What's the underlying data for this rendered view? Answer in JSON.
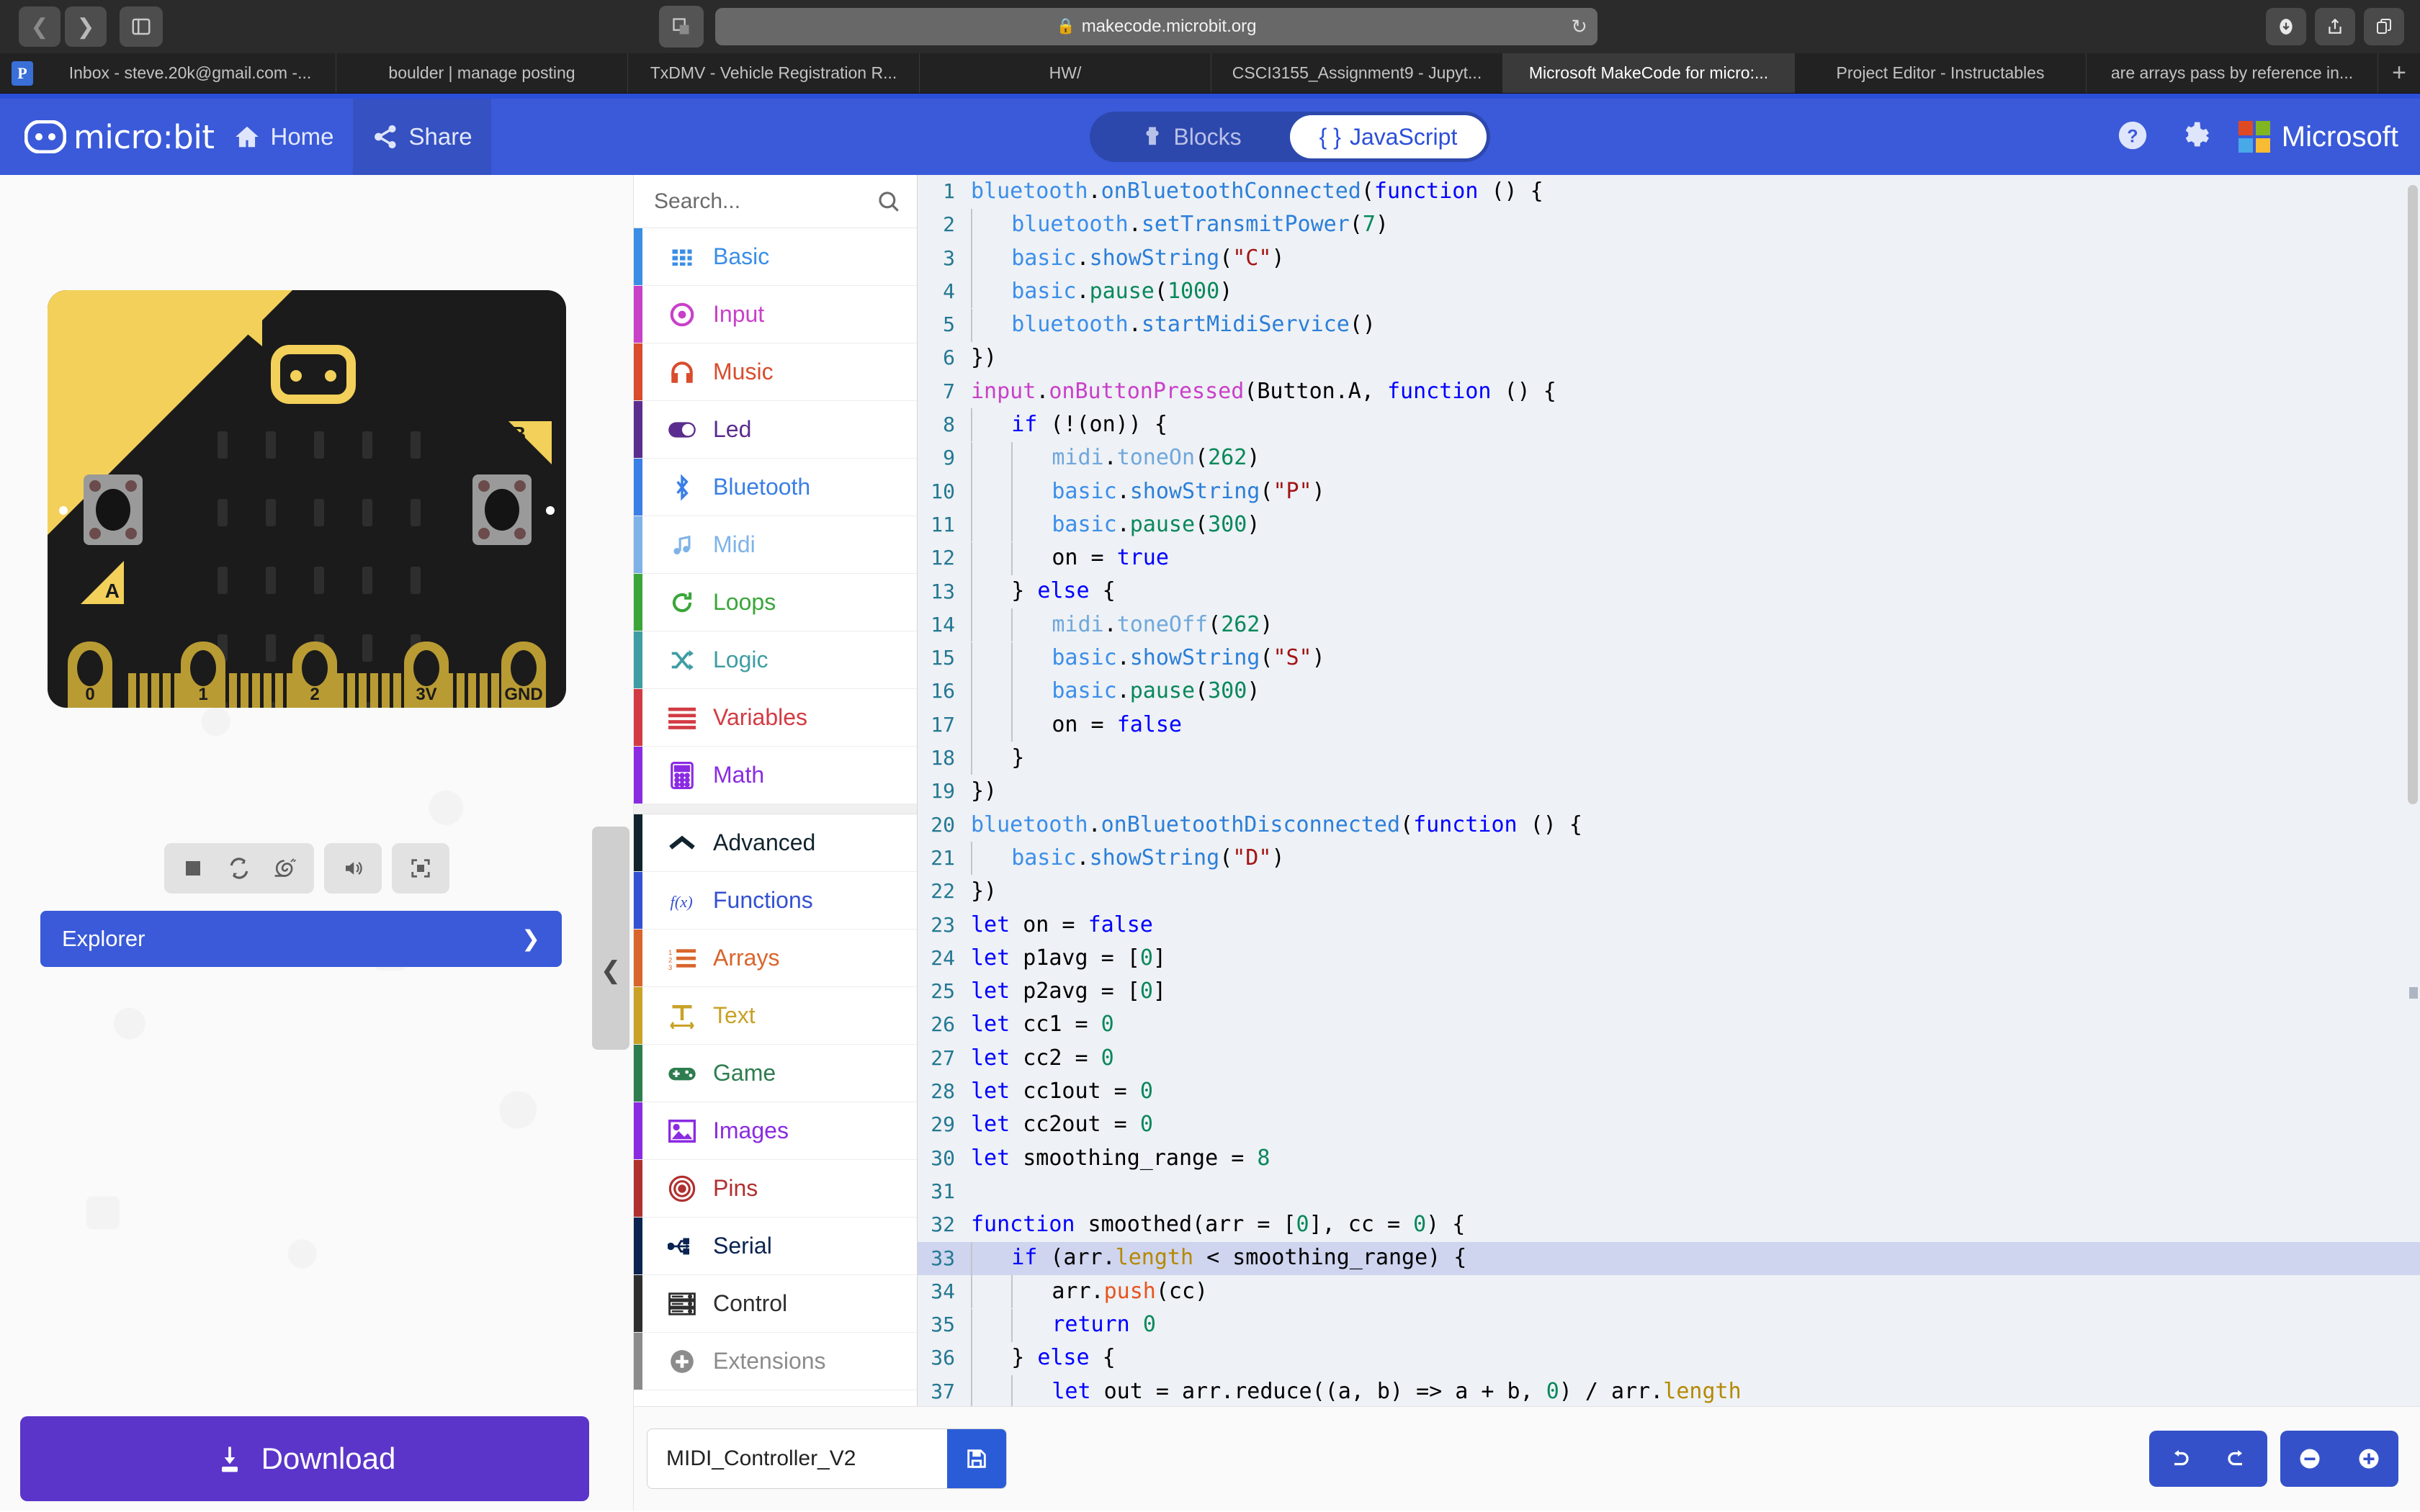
{
  "browser": {
    "url": "makecode.microbit.org",
    "lock_icon": "lock-icon",
    "back_icon": "back-arrow-icon",
    "forward_icon": "forward-arrow-icon",
    "sidebar_icon": "sidebar-toggle-icon",
    "tabgrid_icon": "tab-overview-icon",
    "reload_icon": "reload-icon",
    "download_icon": "downloads-icon",
    "share_icon": "share-icon",
    "tabs_icon": "tabs-icon",
    "favorite_letter": "P",
    "new_tab_label": "+",
    "tabs": [
      {
        "title": "Inbox - steve.20k@gmail.com -...",
        "active": false
      },
      {
        "title": "boulder | manage posting",
        "active": false
      },
      {
        "title": "TxDMV - Vehicle Registration R...",
        "active": false
      },
      {
        "title": "HW/",
        "active": false
      },
      {
        "title": "CSCI3155_Assignment9 - Jupyt...",
        "active": false
      },
      {
        "title": "Microsoft MakeCode for micro:...",
        "active": true
      },
      {
        "title": "Project Editor - Instructables",
        "active": false
      },
      {
        "title": "are arrays pass by reference in...",
        "active": false
      }
    ]
  },
  "header": {
    "brand": "micro:bit",
    "home_label": "Home",
    "share_label": "Share",
    "blocks_label": "Blocks",
    "javascript_label": "JavaScript",
    "javascript_braces": "{ }",
    "help_icon": "help-circle-icon",
    "settings_icon": "gear-icon",
    "microsoft_label": "Microsoft",
    "brand_color": "#3a5ad9"
  },
  "simulator": {
    "board_pins": [
      "0",
      "1",
      "2",
      "3V",
      "GND"
    ],
    "button_a_label": "A",
    "button_b_label": "B",
    "controls": [
      {
        "name": "stop-button",
        "icon": "stop-icon"
      },
      {
        "name": "restart-button",
        "icon": "restart-icon"
      },
      {
        "name": "slow-motion-button",
        "icon": "snail-icon"
      },
      {
        "name": "mute-button",
        "icon": "speaker-icon"
      },
      {
        "name": "fullscreen-button",
        "icon": "fullscreen-icon"
      }
    ],
    "explorer_label": "Explorer",
    "explorer_chevron": "❯",
    "download_label": "Download",
    "download_icon": "download-icon",
    "download_color": "#5b35c9"
  },
  "toolbox": {
    "search_placeholder": "Search...",
    "search_icon": "search-icon",
    "categories": [
      {
        "label": "Basic",
        "color": "#3a8ee6",
        "icon": "grid-icon",
        "group": "core"
      },
      {
        "label": "Input",
        "color": "#c940c9",
        "icon": "target-dot-icon",
        "group": "core"
      },
      {
        "label": "Music",
        "color": "#d94c2c",
        "icon": "headphones-icon",
        "group": "core"
      },
      {
        "label": "Led",
        "color": "#5b2d8e",
        "icon": "toggle-icon",
        "group": "core"
      },
      {
        "label": "Bluetooth",
        "color": "#3a7fe6",
        "icon": "bluetooth-icon",
        "group": "core"
      },
      {
        "label": "Midi",
        "color": "#7fb3e8",
        "icon": "music-note-icon",
        "group": "core"
      },
      {
        "label": "Loops",
        "color": "#3aa63a",
        "icon": "loop-arrow-icon",
        "group": "core"
      },
      {
        "label": "Logic",
        "color": "#3f9da3",
        "icon": "shuffle-icon",
        "group": "core"
      },
      {
        "label": "Variables",
        "color": "#d23b43",
        "icon": "lines-icon",
        "group": "core"
      },
      {
        "label": "Math",
        "color": "#8a2be2",
        "icon": "calculator-icon",
        "group": "core"
      },
      {
        "label": "Advanced",
        "color": "#11242e",
        "icon": "chevron-up-icon",
        "group": "advanced-toggle"
      },
      {
        "label": "Functions",
        "color": "#3451d1",
        "icon": "fx-icon",
        "group": "advanced"
      },
      {
        "label": "Arrays",
        "color": "#d9652c",
        "icon": "numbered-list-icon",
        "group": "advanced"
      },
      {
        "label": "Text",
        "color": "#c9a227",
        "icon": "text-width-icon",
        "group": "advanced"
      },
      {
        "label": "Game",
        "color": "#2e7d4f",
        "icon": "gamepad-icon",
        "group": "advanced"
      },
      {
        "label": "Images",
        "color": "#8a2be2",
        "icon": "picture-icon",
        "group": "advanced"
      },
      {
        "label": "Pins",
        "color": "#b03030",
        "icon": "concentric-circles-icon",
        "group": "advanced"
      },
      {
        "label": "Serial",
        "color": "#0a2351",
        "icon": "usb-icon",
        "group": "advanced"
      },
      {
        "label": "Control",
        "color": "#2e2e2e",
        "icon": "server-icon",
        "group": "advanced"
      },
      {
        "label": "Extensions",
        "color": "#8c8c8c",
        "icon": "plus-circle-icon",
        "group": "advanced"
      }
    ]
  },
  "editor": {
    "project_name": "MIDI_Controller_V2",
    "save_icon": "floppy-disk-icon",
    "undo_icon": "undo-icon",
    "redo_icon": "redo-icon",
    "zoom_out_icon": "minus-circle-icon",
    "zoom_in_icon": "plus-circle-icon",
    "highlighted_line": 33,
    "lines": [
      {
        "n": 1,
        "indent": 0,
        "tokens": [
          [
            "ns",
            "bluetooth"
          ],
          [
            "pl",
            "."
          ],
          [
            "fn",
            "onBluetoothConnected"
          ],
          [
            "pl",
            "("
          ],
          [
            "k",
            "function"
          ],
          [
            "pl",
            " () {"
          ]
        ]
      },
      {
        "n": 2,
        "indent": 1,
        "tokens": [
          [
            "ns",
            "bluetooth"
          ],
          [
            "pl",
            "."
          ],
          [
            "fn",
            "setTransmitPower"
          ],
          [
            "pl",
            "("
          ],
          [
            "num",
            "7"
          ],
          [
            "pl",
            ")"
          ]
        ]
      },
      {
        "n": 3,
        "indent": 1,
        "tokens": [
          [
            "ns",
            "basic"
          ],
          [
            "pl",
            "."
          ],
          [
            "fn",
            "showString"
          ],
          [
            "pl",
            "("
          ],
          [
            "str",
            "\"C\""
          ],
          [
            "pl",
            ")"
          ]
        ]
      },
      {
        "n": 4,
        "indent": 1,
        "tokens": [
          [
            "ns",
            "basic"
          ],
          [
            "pl",
            "."
          ],
          [
            "num",
            "pause"
          ],
          [
            "pl",
            "("
          ],
          [
            "num",
            "1000"
          ],
          [
            "pl",
            ")"
          ]
        ]
      },
      {
        "n": 5,
        "indent": 1,
        "tokens": [
          [
            "ns",
            "bluetooth"
          ],
          [
            "pl",
            "."
          ],
          [
            "fn",
            "startMidiService"
          ],
          [
            "pl",
            "()"
          ]
        ]
      },
      {
        "n": 6,
        "indent": 0,
        "tokens": [
          [
            "pl",
            "})"
          ]
        ]
      },
      {
        "n": 7,
        "indent": 0,
        "tokens": [
          [
            "mg",
            "input"
          ],
          [
            "pl",
            "."
          ],
          [
            "mg",
            "onButtonPressed"
          ],
          [
            "pl",
            "(Button.A, "
          ],
          [
            "k",
            "function"
          ],
          [
            "pl",
            " () {"
          ]
        ]
      },
      {
        "n": 8,
        "indent": 1,
        "tokens": [
          [
            "k",
            "if"
          ],
          [
            "pl",
            " (!(on)) {"
          ]
        ]
      },
      {
        "n": 9,
        "indent": 2,
        "tokens": [
          [
            "lb",
            "midi"
          ],
          [
            "pl",
            "."
          ],
          [
            "lb",
            "toneOn"
          ],
          [
            "pl",
            "("
          ],
          [
            "num",
            "262"
          ],
          [
            "pl",
            ")"
          ]
        ]
      },
      {
        "n": 10,
        "indent": 2,
        "tokens": [
          [
            "ns",
            "basic"
          ],
          [
            "pl",
            "."
          ],
          [
            "fn",
            "showString"
          ],
          [
            "pl",
            "("
          ],
          [
            "str",
            "\"P\""
          ],
          [
            "pl",
            ")"
          ]
        ]
      },
      {
        "n": 11,
        "indent": 2,
        "tokens": [
          [
            "ns",
            "basic"
          ],
          [
            "pl",
            "."
          ],
          [
            "num",
            "pause"
          ],
          [
            "pl",
            "("
          ],
          [
            "num",
            "300"
          ],
          [
            "pl",
            ")"
          ]
        ]
      },
      {
        "n": 12,
        "indent": 2,
        "tokens": [
          [
            "pl",
            "on = "
          ],
          [
            "k",
            "true"
          ]
        ]
      },
      {
        "n": 13,
        "indent": 1,
        "tokens": [
          [
            "pl",
            "} "
          ],
          [
            "k",
            "else"
          ],
          [
            "pl",
            " {"
          ]
        ]
      },
      {
        "n": 14,
        "indent": 2,
        "tokens": [
          [
            "lb",
            "midi"
          ],
          [
            "pl",
            "."
          ],
          [
            "lb",
            "toneOff"
          ],
          [
            "pl",
            "("
          ],
          [
            "num",
            "262"
          ],
          [
            "pl",
            ")"
          ]
        ]
      },
      {
        "n": 15,
        "indent": 2,
        "tokens": [
          [
            "ns",
            "basic"
          ],
          [
            "pl",
            "."
          ],
          [
            "fn",
            "showString"
          ],
          [
            "pl",
            "("
          ],
          [
            "str",
            "\"S\""
          ],
          [
            "pl",
            ")"
          ]
        ]
      },
      {
        "n": 16,
        "indent": 2,
        "tokens": [
          [
            "ns",
            "basic"
          ],
          [
            "pl",
            "."
          ],
          [
            "num",
            "pause"
          ],
          [
            "pl",
            "("
          ],
          [
            "num",
            "300"
          ],
          [
            "pl",
            ")"
          ]
        ]
      },
      {
        "n": 17,
        "indent": 2,
        "tokens": [
          [
            "pl",
            "on = "
          ],
          [
            "k",
            "false"
          ]
        ]
      },
      {
        "n": 18,
        "indent": 1,
        "tokens": [
          [
            "pl",
            "}"
          ]
        ]
      },
      {
        "n": 19,
        "indent": 0,
        "tokens": [
          [
            "pl",
            "})"
          ]
        ]
      },
      {
        "n": 20,
        "indent": 0,
        "tokens": [
          [
            "ns",
            "bluetooth"
          ],
          [
            "pl",
            "."
          ],
          [
            "fn",
            "onBluetoothDisconnected"
          ],
          [
            "pl",
            "("
          ],
          [
            "k",
            "function"
          ],
          [
            "pl",
            " () {"
          ]
        ]
      },
      {
        "n": 21,
        "indent": 1,
        "tokens": [
          [
            "ns",
            "basic"
          ],
          [
            "pl",
            "."
          ],
          [
            "fn",
            "showString"
          ],
          [
            "pl",
            "("
          ],
          [
            "str",
            "\"D\""
          ],
          [
            "pl",
            ")"
          ]
        ]
      },
      {
        "n": 22,
        "indent": 0,
        "tokens": [
          [
            "pl",
            "})"
          ]
        ]
      },
      {
        "n": 23,
        "indent": 0,
        "tokens": [
          [
            "k",
            "let"
          ],
          [
            "pl",
            " on = "
          ],
          [
            "k",
            "false"
          ]
        ]
      },
      {
        "n": 24,
        "indent": 0,
        "tokens": [
          [
            "k",
            "let"
          ],
          [
            "pl",
            " p1avg = ["
          ],
          [
            "num",
            "0"
          ],
          [
            "pl",
            "]"
          ]
        ]
      },
      {
        "n": 25,
        "indent": 0,
        "tokens": [
          [
            "k",
            "let"
          ],
          [
            "pl",
            " p2avg = ["
          ],
          [
            "num",
            "0"
          ],
          [
            "pl",
            "]"
          ]
        ]
      },
      {
        "n": 26,
        "indent": 0,
        "tokens": [
          [
            "k",
            "let"
          ],
          [
            "pl",
            " cc1 = "
          ],
          [
            "num",
            "0"
          ]
        ]
      },
      {
        "n": 27,
        "indent": 0,
        "tokens": [
          [
            "k",
            "let"
          ],
          [
            "pl",
            " cc2 = "
          ],
          [
            "num",
            "0"
          ]
        ]
      },
      {
        "n": 28,
        "indent": 0,
        "tokens": [
          [
            "k",
            "let"
          ],
          [
            "pl",
            " cc1out = "
          ],
          [
            "num",
            "0"
          ]
        ]
      },
      {
        "n": 29,
        "indent": 0,
        "tokens": [
          [
            "k",
            "let"
          ],
          [
            "pl",
            " cc2out = "
          ],
          [
            "num",
            "0"
          ]
        ]
      },
      {
        "n": 30,
        "indent": 0,
        "tokens": [
          [
            "k",
            "let"
          ],
          [
            "pl",
            " smoothing_range = "
          ],
          [
            "num",
            "8"
          ]
        ]
      },
      {
        "n": 31,
        "indent": 0,
        "tokens": []
      },
      {
        "n": 32,
        "indent": 0,
        "tokens": [
          [
            "k",
            "function"
          ],
          [
            "pl",
            " smoothed(arr = ["
          ],
          [
            "num",
            "0"
          ],
          [
            "pl",
            "], cc = "
          ],
          [
            "num",
            "0"
          ],
          [
            "pl",
            ") {"
          ]
        ]
      },
      {
        "n": 33,
        "indent": 1,
        "tokens": [
          [
            "k",
            "if"
          ],
          [
            "pl",
            " (arr."
          ],
          [
            "prop",
            "length"
          ],
          [
            "pl",
            " < smoothing_range) {"
          ]
        ]
      },
      {
        "n": 34,
        "indent": 2,
        "tokens": [
          [
            "pl",
            "arr."
          ],
          [
            "push",
            "push"
          ],
          [
            "pl",
            "(cc)"
          ]
        ]
      },
      {
        "n": 35,
        "indent": 2,
        "tokens": [
          [
            "k",
            "return"
          ],
          [
            "pl",
            " "
          ],
          [
            "num",
            "0"
          ]
        ]
      },
      {
        "n": 36,
        "indent": 1,
        "tokens": [
          [
            "pl",
            "} "
          ],
          [
            "k",
            "else"
          ],
          [
            "pl",
            " {"
          ]
        ]
      },
      {
        "n": 37,
        "indent": 2,
        "tokens": [
          [
            "k",
            "let"
          ],
          [
            "pl",
            " out = arr.reduce((a, b) => a + b, "
          ],
          [
            "num",
            "0"
          ],
          [
            "pl",
            ") / arr."
          ],
          [
            "prop",
            "length"
          ]
        ]
      }
    ]
  }
}
